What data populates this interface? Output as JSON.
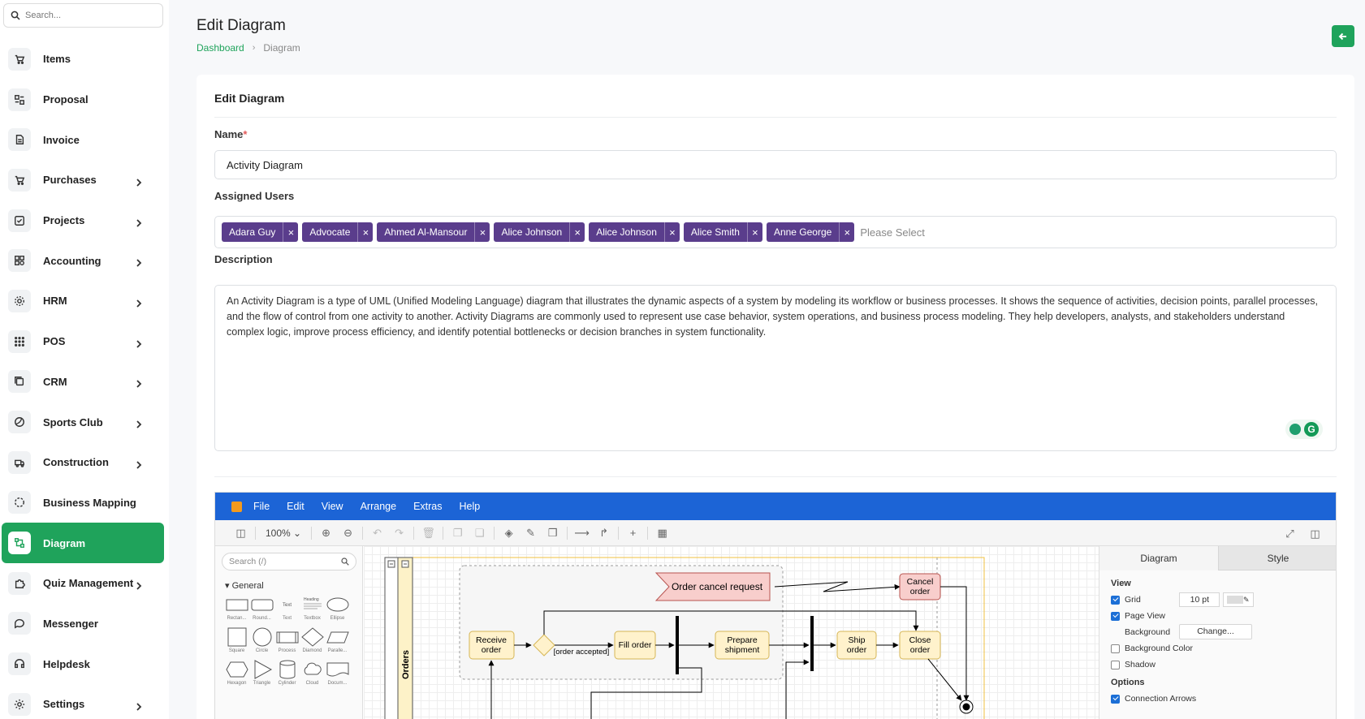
{
  "sidebar": {
    "search_placeholder": "Search...",
    "items": [
      {
        "label": "Items",
        "icon": "cart-icon",
        "chevron": false
      },
      {
        "label": "Proposal",
        "icon": "proposal-icon",
        "chevron": false
      },
      {
        "label": "Invoice",
        "icon": "invoice-icon",
        "chevron": false
      },
      {
        "label": "Purchases",
        "icon": "cart-icon",
        "chevron": true
      },
      {
        "label": "Projects",
        "icon": "check-square-icon",
        "chevron": true
      },
      {
        "label": "Accounting",
        "icon": "grid-icon",
        "chevron": true
      },
      {
        "label": "HRM",
        "icon": "hrm-icon",
        "chevron": true
      },
      {
        "label": "POS",
        "icon": "dots-grid-icon",
        "chevron": true
      },
      {
        "label": "CRM",
        "icon": "crm-icon",
        "chevron": true
      },
      {
        "label": "Sports Club",
        "icon": "ball-icon",
        "chevron": true
      },
      {
        "label": "Construction",
        "icon": "truck-icon",
        "chevron": true
      },
      {
        "label": "Business Mapping",
        "icon": "circle-dashed-icon",
        "chevron": false
      },
      {
        "label": "Diagram",
        "icon": "diagram-icon",
        "chevron": false,
        "active": true
      },
      {
        "label": "Quiz Management",
        "icon": "puzzle-icon",
        "chevron": true
      },
      {
        "label": "Messenger",
        "icon": "chat-icon",
        "chevron": false
      },
      {
        "label": "Helpdesk",
        "icon": "headset-icon",
        "chevron": false
      },
      {
        "label": "Settings",
        "icon": "gear-icon",
        "chevron": true
      }
    ]
  },
  "header": {
    "title": "Edit Diagram",
    "breadcrumb": [
      "Dashboard",
      "Diagram"
    ],
    "back_icon": "arrow-left-icon"
  },
  "form": {
    "card_title": "Edit Diagram",
    "name_label": "Name",
    "required_mark": "*",
    "name_value": "Activity Diagram",
    "users_label": "Assigned Users",
    "users": [
      "Adara Guy",
      "Advocate",
      "Ahmed Al-Mansour",
      "Alice Johnson",
      "Alice Johnson",
      "Alice Smith",
      "Anne George"
    ],
    "users_placeholder": "Please Select",
    "description_label": "Description",
    "description": "An Activity Diagram is a type of UML (Unified Modeling Language) diagram that illustrates the dynamic aspects of a system by modeling its workflow or business processes. It shows the sequence of activities, decision points, parallel processes, and the flow of control from one activity to another. Activity Diagrams are commonly used to represent use case behavior, system operations, and business process modeling. They help developers, analysts, and stakeholders understand complex logic, improve process efficiency, and identify potential bottlenecks or decision branches in system functionality."
  },
  "editor": {
    "menus": [
      "File",
      "Edit",
      "View",
      "Arrange",
      "Extras",
      "Help"
    ],
    "zoom": "100%",
    "shape_search_placeholder": "Search (/)",
    "shape_section": "General",
    "shapes_row1": [
      "Rectan...",
      "Round...",
      "Text",
      "Textbox",
      "Ellipse"
    ],
    "shapes_row2": [
      "Square",
      "Circle",
      "Process",
      "Diamond",
      "Paralle..."
    ],
    "shapes_row3": [
      "Hexagon",
      "Triangle",
      "Cylinder",
      "Cloud",
      "Docum..."
    ],
    "shape_icon_texts": [
      "Text",
      "Heading"
    ],
    "diagram": {
      "swimlane": "Orders",
      "signal": "Order cancel request",
      "cancel_order": [
        "Cancel",
        "order"
      ],
      "receive_order": [
        "Receive",
        "order"
      ],
      "guard": "[order accepted]",
      "fill_order": "Fill order",
      "prepare_shipment": [
        "Prepare",
        "shipment"
      ],
      "ship_order": [
        "Ship",
        "order"
      ],
      "close_order": [
        "Close",
        "order"
      ]
    },
    "panel": {
      "tabs": [
        "Diagram",
        "Style"
      ],
      "view_label": "View",
      "grid_label": "Grid",
      "grid_size": "10 pt",
      "page_view_label": "Page View",
      "background_label": "Background",
      "change_btn": "Change...",
      "bg_color_label": "Background Color",
      "shadow_label": "Shadow",
      "options_label": "Options",
      "conn_arrows_label": "Connection Arrows",
      "grid_on": true,
      "page_view_on": true,
      "bg_color_on": false,
      "shadow_on": false,
      "conn_arrows_on": true
    }
  }
}
